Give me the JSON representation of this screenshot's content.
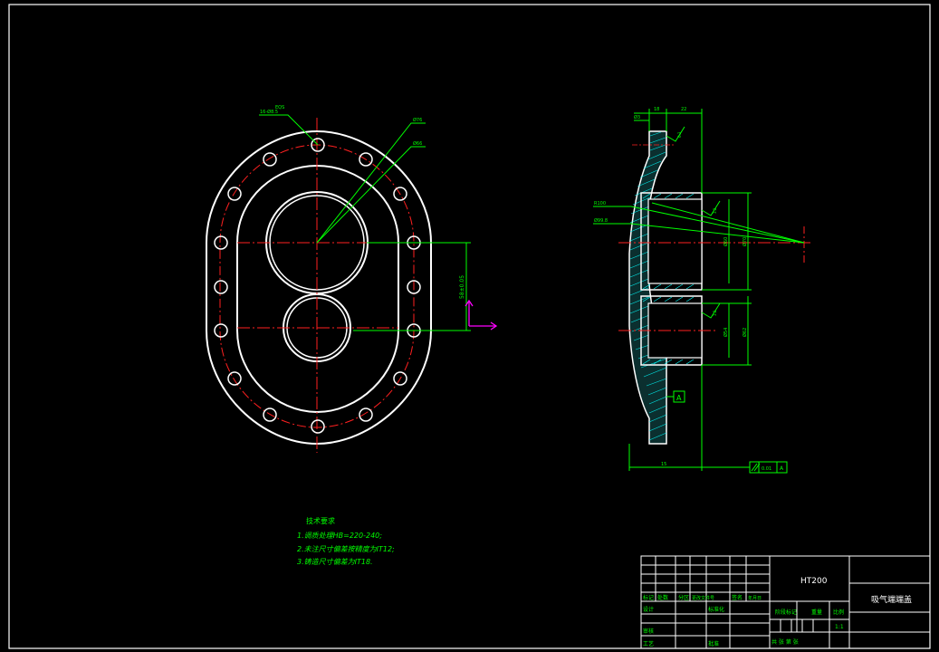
{
  "drawing": {
    "material": "HT200",
    "part_name": "吸气端端盖",
    "scale": "1:1"
  },
  "tech_requirements": {
    "title": "技术要求",
    "items": [
      "1.调质处理HB=220-240;",
      "2.未注尺寸偏差按精度为IT12;",
      "3.铸造尺寸偏差为IT18."
    ]
  },
  "front_view_labels": {
    "hole_callout": "16-Ø8.5",
    "hole_callout_sub": "EQS",
    "dia_large": "Ø76",
    "dia_small": "Ø66",
    "center_distance": "58±0.05"
  },
  "side_view_labels": {
    "top_dim_1": "18",
    "top_dim_2": "22",
    "left_ref": "Ø3",
    "radius_1": "R100",
    "radius_2": "Ø99.8",
    "dia_a": "Ø60",
    "dia_b": "Ø70",
    "dia_c": "Ø54",
    "dia_d": "Ø62",
    "roughness_1": "6.3",
    "roughness_2": "3.2",
    "roughness_3": "3.2",
    "datum": "A",
    "bottom_dim": "15",
    "parallel_tol": "0.01",
    "parallel_datum": "A"
  },
  "title_block": {
    "row_labels": [
      "标记",
      "处数",
      "分区",
      "更改文件号",
      "签名",
      "年月日"
    ],
    "design": "设计",
    "standardize": "标准化",
    "review": "审核",
    "process": "工艺",
    "approve": "批准",
    "stage_mark": "阶段标记",
    "weight": "重量",
    "scale_label": "比例",
    "sheets": "共 张 第 张"
  },
  "colors": {
    "line": "#ffffff",
    "center": "#ff2020",
    "dim": "#00ff00",
    "axis": "#ff00ff",
    "hatch": "#00ffff"
  }
}
